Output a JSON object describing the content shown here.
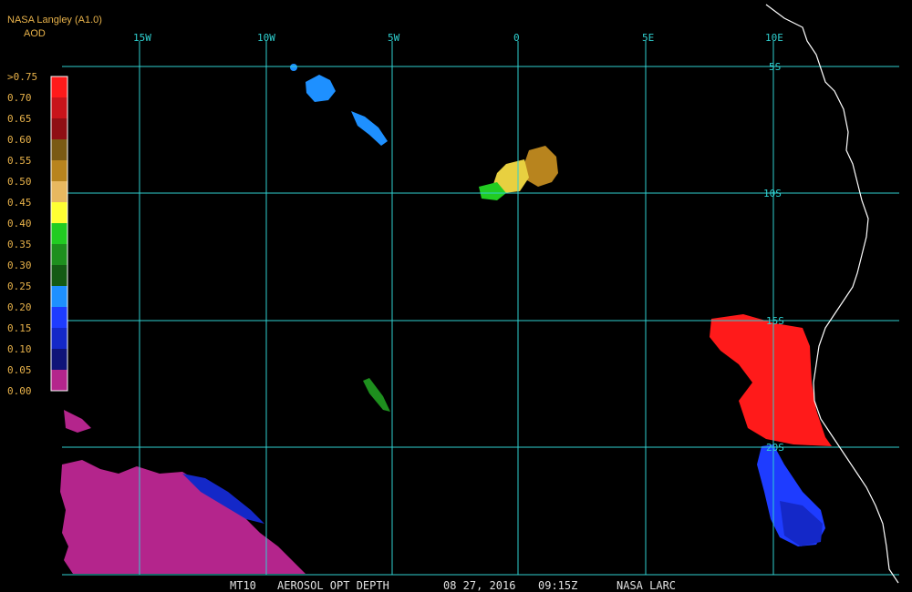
{
  "header": {
    "title": "NASA Langley (A1.0)",
    "subtitle": "AOD"
  },
  "legend": {
    "labels": [
      ">0.75",
      "0.70",
      "0.65",
      "0.60",
      "0.55",
      "0.50",
      "0.45",
      "0.40",
      "0.35",
      "0.30",
      "0.25",
      "0.20",
      "0.15",
      "0.10",
      "0.05",
      "0.00"
    ],
    "colors": [
      "#ff1a1a",
      "#c8141a",
      "#8f0f14",
      "#7a5a14",
      "#b8841e",
      "#e8b860",
      "#ffff33",
      "#22cc22",
      "#1e8f1e",
      "#145a14",
      "#1e90ff",
      "#1e3cff",
      "#1428c8",
      "#0f1478",
      "#b4258c"
    ]
  },
  "map": {
    "grid_color": "#2fd0d0",
    "coast_color": "#ffffff",
    "lon_labels": [
      "15W",
      "10W",
      "5W",
      "0",
      "5E",
      "10E"
    ],
    "lat_labels": [
      "5S",
      "10S",
      "15S",
      "20S"
    ]
  },
  "footer": {
    "satellite": "MT10",
    "product": "AEROSOL OPT DEPTH",
    "date": "08 27, 2016",
    "time": "09:15Z",
    "credit": "NASA LARC"
  }
}
